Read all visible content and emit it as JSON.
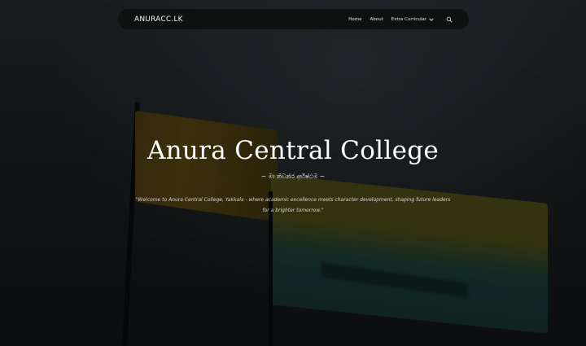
{
  "nav": {
    "brand": "ANURACC.LK",
    "items": [
      {
        "label": "Home"
      },
      {
        "label": "About"
      },
      {
        "label": "Extra Curricular"
      }
    ],
    "search_icon": "search-icon",
    "dropdown_icon": "chevron-down-icon"
  },
  "hero": {
    "title": "Anura Central College",
    "motto": "~ මා නිවන්ර අභිෂ්ඨම ~",
    "quote": "\"Welcome to Anura Central College, Yakkala - where academic excellence meets character development, shaping future leaders for a brighter tomorrow.\""
  },
  "colors": {
    "nav_bg": "#0f1111",
    "overlay": "#000000",
    "text": "#ffffff"
  }
}
